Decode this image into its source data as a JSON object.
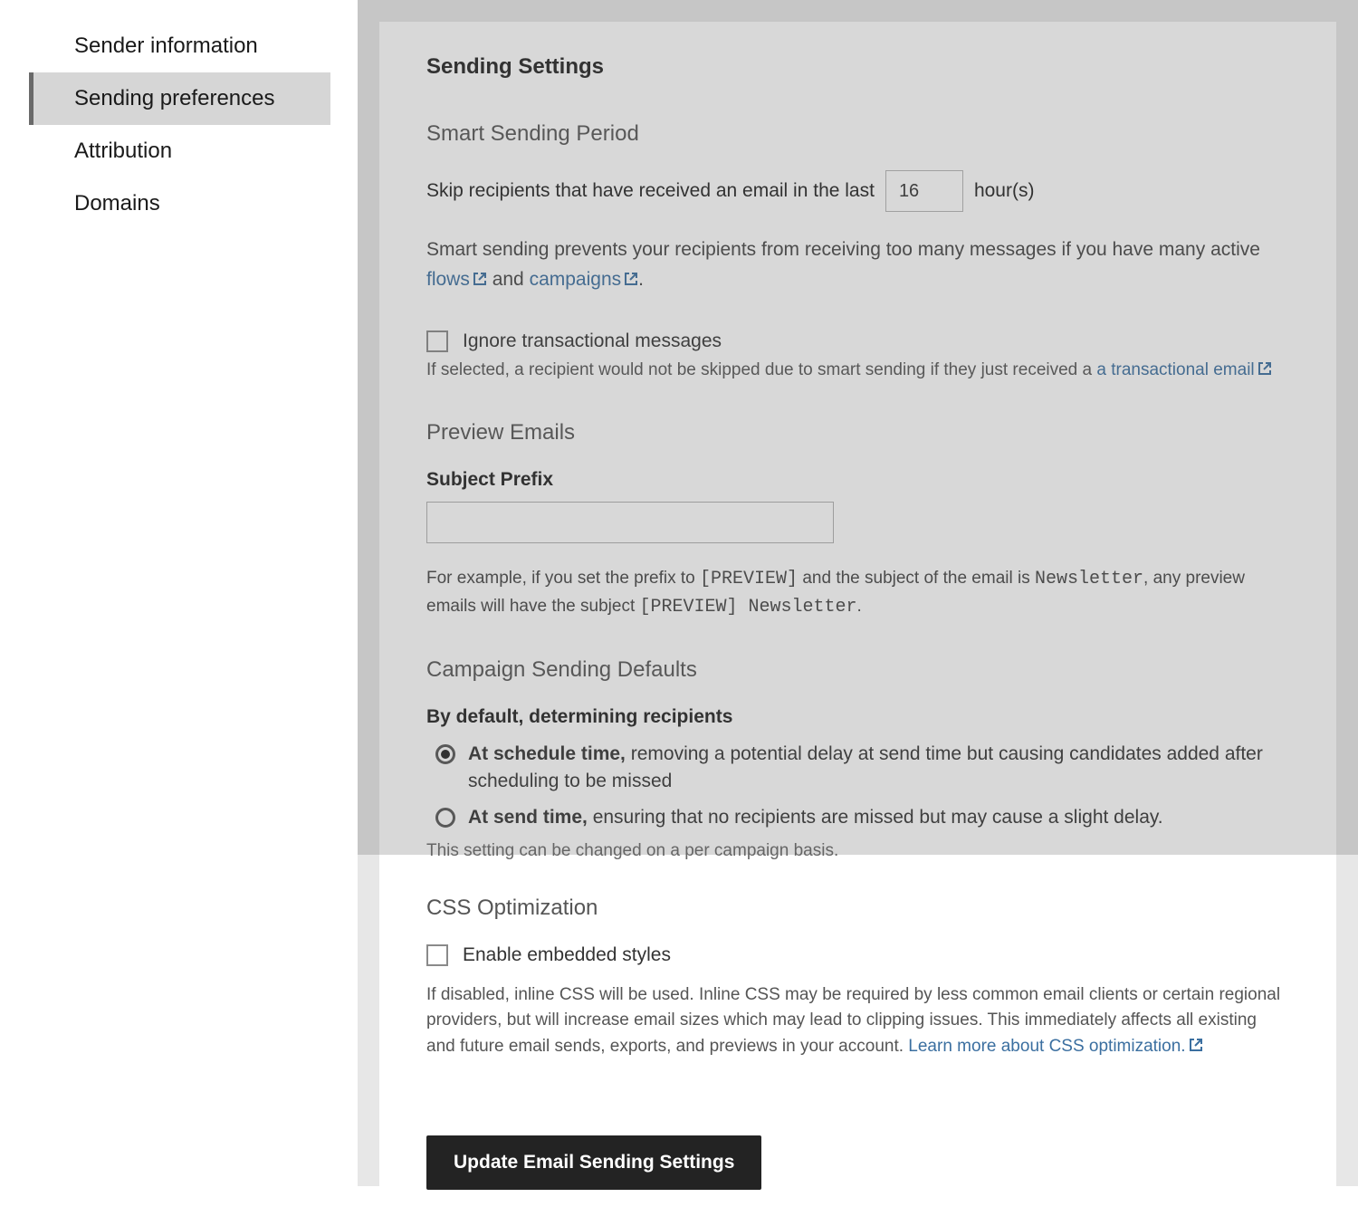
{
  "sidebar": {
    "items": [
      {
        "label": "Sender information"
      },
      {
        "label": "Sending preferences"
      },
      {
        "label": "Attribution"
      },
      {
        "label": "Domains"
      }
    ],
    "active_index": 1
  },
  "main": {
    "title": "Sending Settings",
    "smart_sending": {
      "heading": "Smart Sending Period",
      "skip_prefix": "Skip recipients that have received an email in the last",
      "hours_value": "16",
      "hours_suffix": "hour(s)",
      "help_prefix": "Smart sending prevents your recipients from receiving too many messages if you have many active ",
      "flows_link": "flows",
      "help_mid": " and ",
      "campaigns_link": "campaigns",
      "help_end": ".",
      "ignore_label": "Ignore transactional messages",
      "ignore_help_prefix": "If selected, a recipient would not be skipped due to smart sending if they just received a ",
      "transactional_link": "a transactional email"
    },
    "preview_emails": {
      "heading": "Preview Emails",
      "subject_prefix_label": "Subject Prefix",
      "subject_prefix_value": "",
      "example_prefix": "For example, if you set the prefix to ",
      "example_code1": "[PREVIEW]",
      "example_mid": " and the subject of the email is ",
      "example_code2": "Newsletter",
      "example_mid2": ", any preview emails will have the subject ",
      "example_code3": "[PREVIEW] Newsletter",
      "example_end": "."
    },
    "campaign_defaults": {
      "heading": "Campaign Sending Defaults",
      "intro": "By default, determining recipients",
      "options": [
        {
          "bold": "At schedule time,",
          "rest": " removing a potential delay at send time but causing candidates added after scheduling to be missed",
          "selected": true
        },
        {
          "bold": "At send time,",
          "rest": " ensuring that no recipients are missed but may cause a slight delay.",
          "selected": false
        }
      ],
      "note": "This setting can be changed on a per campaign basis."
    },
    "css_opt": {
      "heading": "CSS Optimization",
      "checkbox_label": "Enable embedded styles",
      "help": "If disabled, inline CSS will be used. Inline CSS may be required by less common email clients or certain regional providers, but will increase email sizes which may lead to clipping issues. This immediately affects all existing and future email sends, exports, and previews in your account. ",
      "learn_more": "Learn more about CSS optimization."
    },
    "submit_label": "Update Email Sending Settings"
  }
}
